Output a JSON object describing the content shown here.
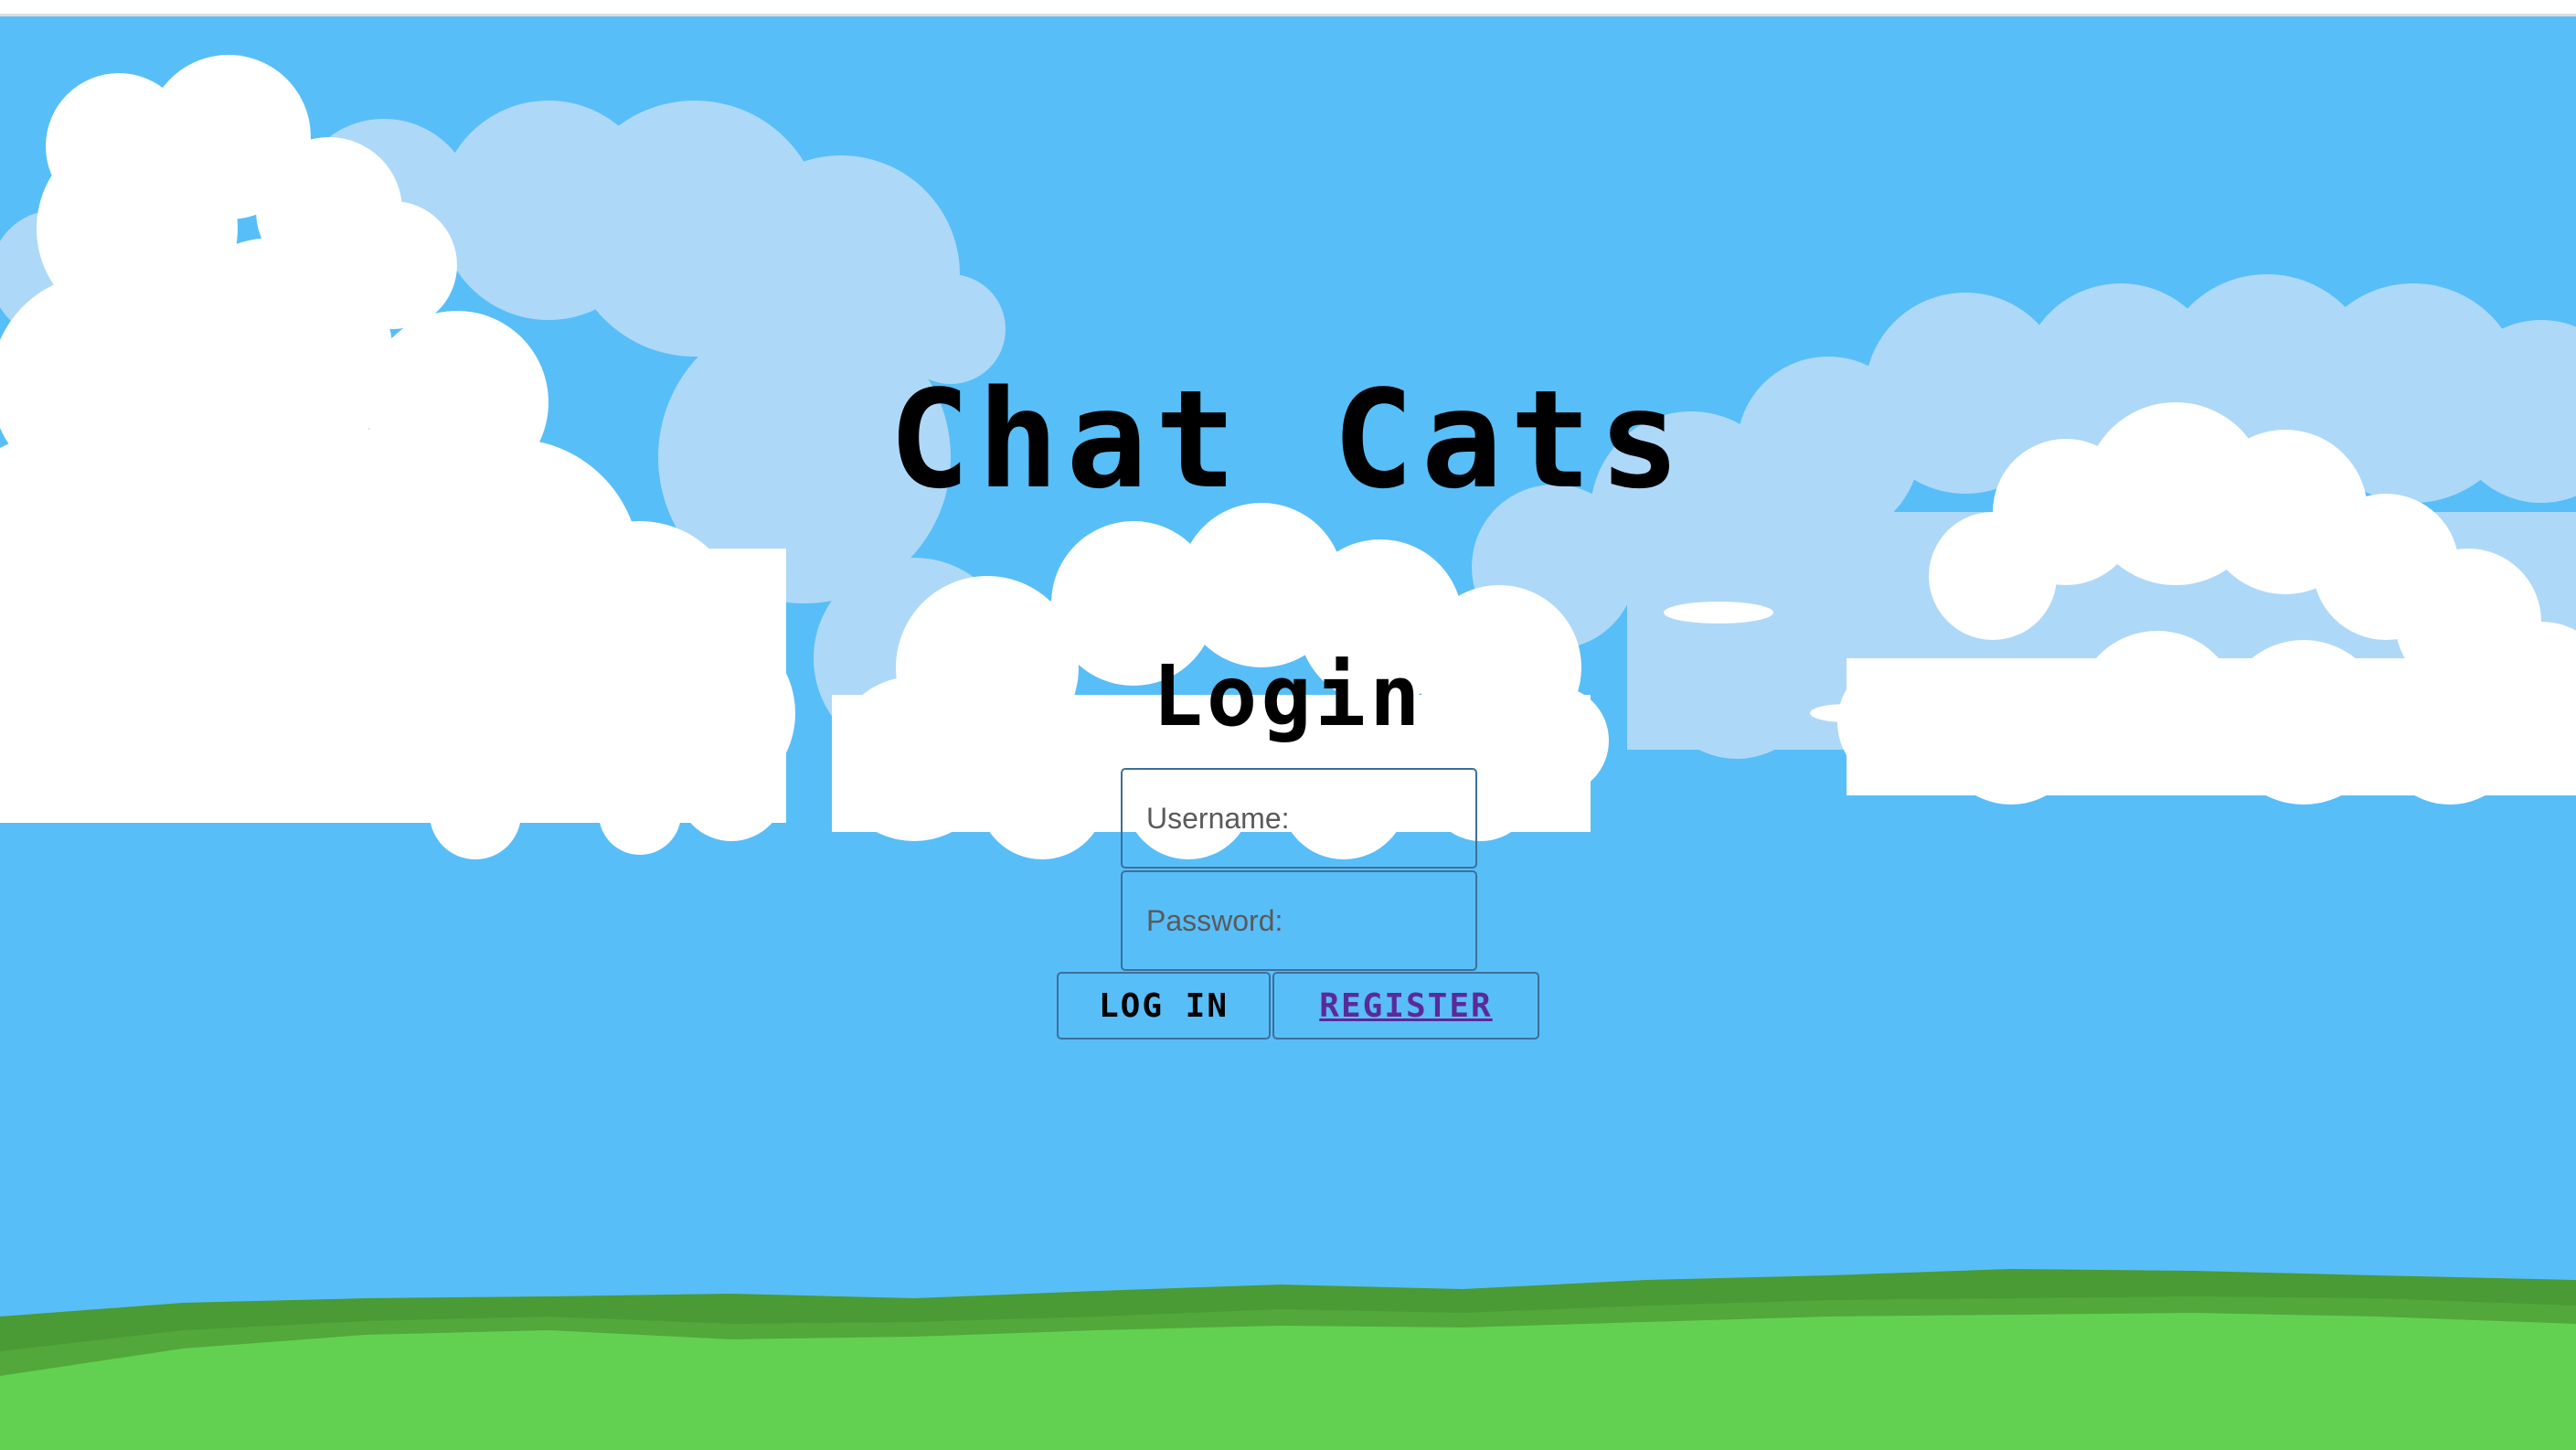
{
  "app": {
    "title": "Chat Cats"
  },
  "form": {
    "heading": "Login",
    "username_placeholder": "Username:",
    "password_placeholder": "Password:",
    "login_label": "LOG IN",
    "register_label": "REGISTER"
  },
  "colors": {
    "sky": "#58bef8",
    "cloud": "#ffffff",
    "cloud_back": "#aed8f8",
    "grass": "#62d151",
    "grass_dark": "#4a9a35",
    "register_link": "#5b2a9a"
  }
}
